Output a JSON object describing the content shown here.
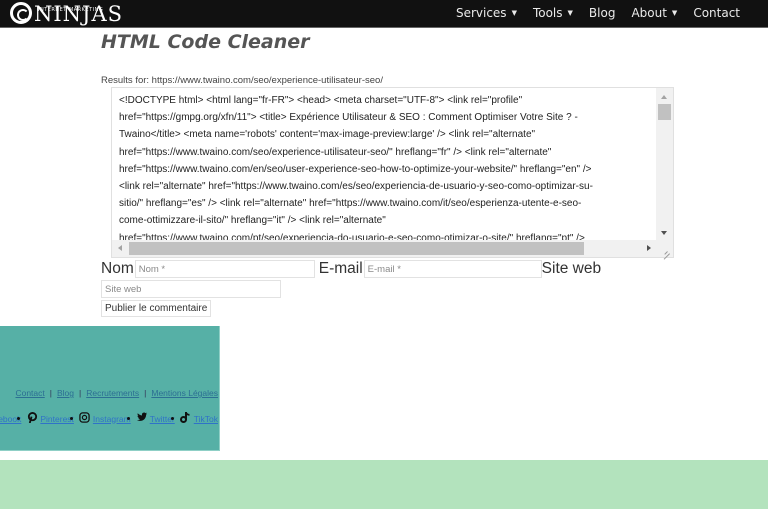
{
  "header": {
    "logo": {
      "tagline": "INTERNET MARKETING",
      "name": "NINJAS"
    },
    "nav": [
      {
        "label": "Services",
        "has_dropdown": true
      },
      {
        "label": "Tools",
        "has_dropdown": true
      },
      {
        "label": "Blog",
        "has_dropdown": false
      },
      {
        "label": "About",
        "has_dropdown": true
      },
      {
        "label": "Contact",
        "has_dropdown": false
      }
    ],
    "caret_glyph": "▼"
  },
  "main": {
    "title": "HTML Code Cleaner",
    "results_label": "Results for: https://www.twaino.com/seo/experience-utilisateur-seo/",
    "code_lines": [
      "<!DOCTYPE html> <html lang=\"fr-FR\"> <head> <meta charset=\"UTF-8\"> <link rel=\"profile\"",
      "href=\"https://gmpg.org/xfn/11\"> <title> Expérience Utilisateur & SEO : Comment Optimiser Votre Site ? -",
      "Twaino</title> <meta name='robots' content='max-image-preview:large' /> <link rel=\"alternate\"",
      "href=\"https://www.twaino.com/seo/experience-utilisateur-seo/\" hreflang=\"fr\" /> <link rel=\"alternate\"",
      "href=\"https://www.twaino.com/en/seo/user-experience-seo-how-to-optimize-your-website/\" hreflang=\"en\" />",
      "<link rel=\"alternate\" href=\"https://www.twaino.com/es/seo/experiencia-de-usuario-y-seo-como-optimizar-su-",
      "sitio/\" hreflang=\"es\" /> <link rel=\"alternate\" href=\"https://www.twaino.com/it/seo/esperienza-utente-e-seo-",
      "come-ottimizzare-il-sito/\" hreflang=\"it\" /> <link rel=\"alternate\"",
      "href=\"https://www.twaino.com/pt/seo/experiencia-do-usuario-e-seo-como-otimizar-o-site/\" hreflang=\"pt\" />"
    ]
  },
  "comment_form": {
    "name_label": "Nom",
    "name_placeholder": "Nom *",
    "email_label": "E-mail",
    "email_placeholder": "E-mail *",
    "website_label": "Site web",
    "website_placeholder": "Site web",
    "submit_label": "Publier le commentaire"
  },
  "footer": {
    "links": [
      "Contact",
      "Blog",
      "Recrutements",
      "Mentions Légales"
    ],
    "separator": "|",
    "social": [
      {
        "icon": "facebook-icon",
        "glyph": "",
        "label": "Facebook"
      },
      {
        "icon": "pinterest-icon",
        "glyph": "℗",
        "label": "Pinterest"
      },
      {
        "icon": "instagram-icon",
        "glyph": "◙",
        "label": "Instagram"
      },
      {
        "icon": "twitter-icon",
        "glyph": "🐦",
        "label": "Twitter"
      },
      {
        "icon": "tiktok-icon",
        "glyph": "♪",
        "label": "TikTok"
      }
    ]
  },
  "colors": {
    "navbar_bg": "#111111",
    "footer_box_bg": "#56b0a6",
    "bottom_band_bg": "#b3e3bd",
    "link_color": "#2f72c8"
  }
}
